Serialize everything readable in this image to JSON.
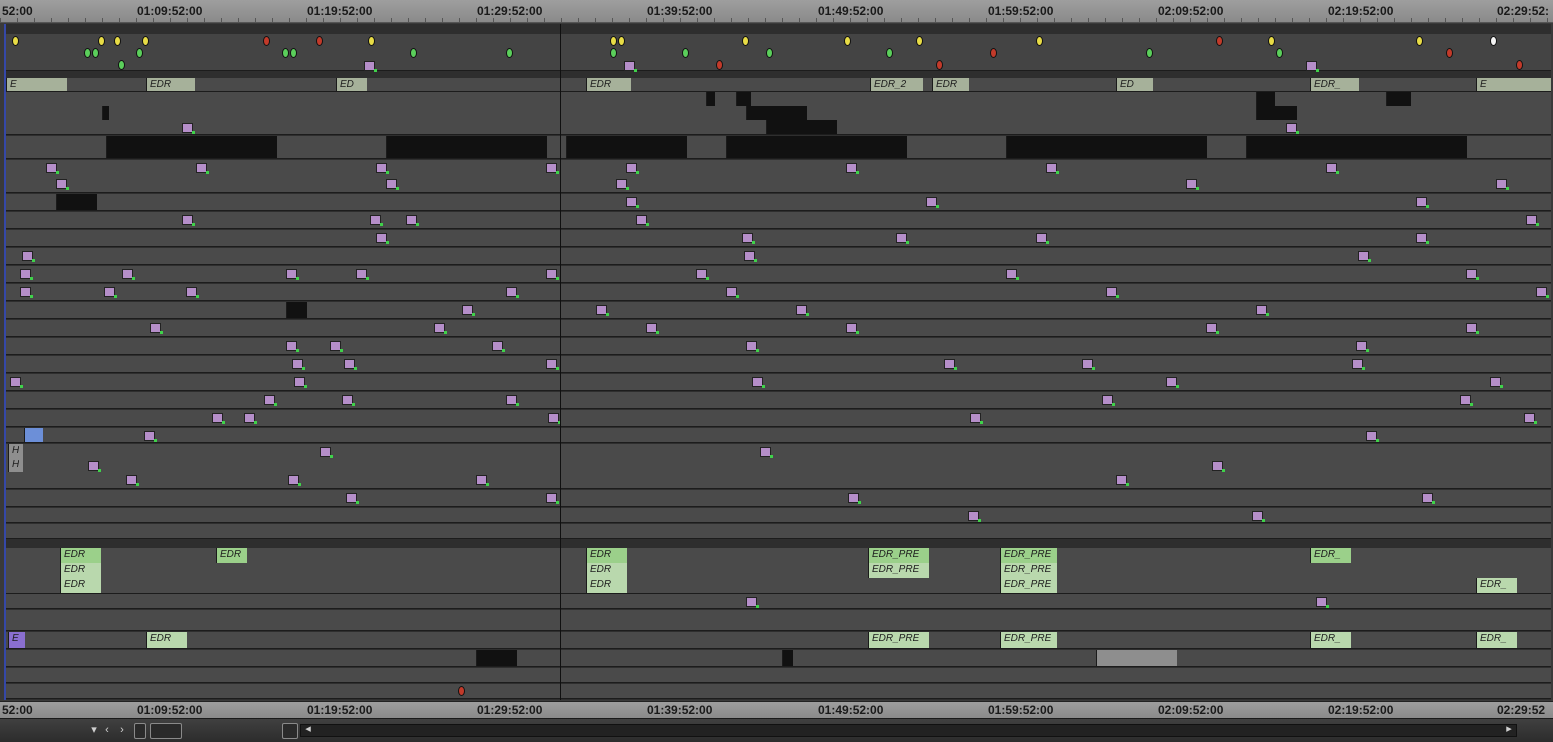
{
  "ruler_top": {
    "timecodes": [
      "52:00",
      "01:09:52:00",
      "01:19:52:00",
      "01:29:52:00",
      "01:39:52:00",
      "01:49:52:00",
      "01:59:52:00",
      "02:09:52:00",
      "02:19:52:00",
      "02:29:52:"
    ]
  },
  "ruler_bottom": {
    "timecodes": [
      "52:00",
      "01:09:52:00",
      "01:19:52:00",
      "01:29:52:00",
      "01:39:52:00",
      "01:49:52:00",
      "01:59:52:00",
      "02:09:52:00",
      "02:19:52:00",
      "02:29:52"
    ]
  },
  "clip_labels": {
    "edr": "EDR",
    "edr_2": "EDR_2",
    "edr_pre": "EDR_PRE",
    "edr_underscore": "EDR_",
    "ed": "ED",
    "e": "E",
    "h": "H"
  },
  "colors": {
    "audio_clip": "#9bd08a",
    "dialog_clip": "#b9d8ad",
    "video_clip": "#a6b19a",
    "alt_clip": "#8a6fd0",
    "marker_yellow": "#e8dc46",
    "marker_green": "#5bcf5b",
    "marker_red": "#c23a2a",
    "playhead": "#101010"
  },
  "footer": {
    "menu_arrow": "▾",
    "prev_icon": "chevron-left-icon",
    "next_icon": "chevron-right-icon",
    "zoom_icon": "zoom-icon",
    "scroll_left": "◂",
    "scroll_right": "▸"
  }
}
